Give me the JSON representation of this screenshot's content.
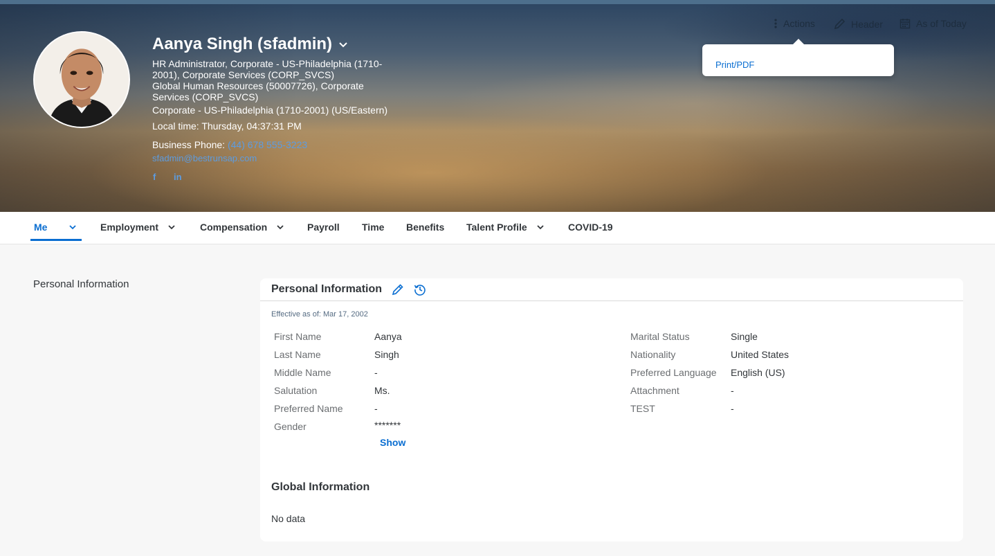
{
  "header": {
    "name": "Aanya Singh (sfadmin)",
    "line1": "HR Administrator, Corporate - US-Philadelphia (1710-",
    "line2": "2001), Corporate Services (CORP_SVCS)",
    "line3": "Global Human Resources (50007726), Corporate",
    "line4": "Services (CORP_SVCS)",
    "line5": "Corporate - US-Philadelphia (1710-2001) (US/Eastern)",
    "local_time": "Local time: Thursday, 04:37:31 PM",
    "phone_label": "Business Phone: ",
    "phone_value": "(44) 678 555-3223",
    "email": "sfadmin@bestrunsap.com",
    "social_facebook": "f",
    "social_linkedin": "in"
  },
  "toolbar": {
    "actions": "Actions",
    "header": "Header",
    "as_of_today": "As of Today"
  },
  "popover": {
    "item": "Print/PDF"
  },
  "tabs": [
    {
      "label": "Me"
    },
    {
      "label": "Employment"
    },
    {
      "label": "Compensation"
    },
    {
      "label": "Payroll"
    },
    {
      "label": "Time"
    },
    {
      "label": "Benefits"
    },
    {
      "label": "Talent Profile"
    },
    {
      "label": "COVID-19"
    }
  ],
  "leftnav": {
    "personal_information": "Personal Information"
  },
  "card": {
    "title": "Personal Information",
    "effective_label": "Effective as of:",
    "effective_date": "Mar 17, 2002",
    "left_fields": [
      {
        "label": "First Name",
        "value": "Aanya"
      },
      {
        "label": "Last Name",
        "value": "Singh"
      },
      {
        "label": "Middle Name",
        "value": "-"
      },
      {
        "label": "Salutation",
        "value": "Ms."
      },
      {
        "label": "Preferred Name",
        "value": "-"
      },
      {
        "label": "Gender",
        "value": "*******"
      }
    ],
    "show_link": "Show",
    "right_fields": [
      {
        "label": "Marital Status",
        "value": "Single"
      },
      {
        "label": "Nationality",
        "value": "United States"
      },
      {
        "label": "Preferred Language",
        "value": "English (US)"
      },
      {
        "label": "Attachment",
        "value": "-"
      },
      {
        "label": "TEST",
        "value": "-"
      }
    ],
    "global_title": "Global Information",
    "global_nodata": "No data"
  },
  "colors": {
    "accent": "#0a6ed1",
    "link_on_banner": "#5d9ce0"
  }
}
